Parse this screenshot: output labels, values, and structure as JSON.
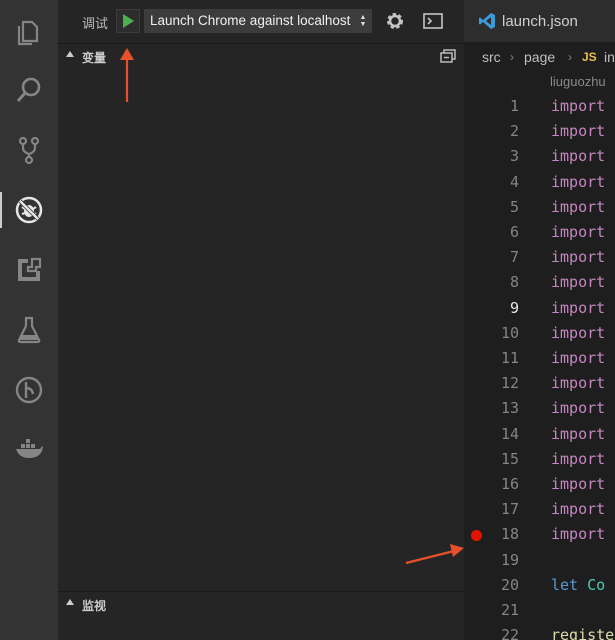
{
  "activity_bar": {
    "items": [
      {
        "name": "explorer",
        "icon": "files-icon"
      },
      {
        "name": "search",
        "icon": "search-icon"
      },
      {
        "name": "source-control",
        "icon": "git-branch-icon"
      },
      {
        "name": "debug",
        "icon": "debug-no-bug-icon",
        "active": true
      },
      {
        "name": "extensions",
        "icon": "extensions-icon"
      },
      {
        "name": "test",
        "icon": "flask-icon"
      },
      {
        "name": "git-lens",
        "icon": "git-history-icon"
      },
      {
        "name": "docker",
        "icon": "docker-whale-icon"
      }
    ]
  },
  "debug": {
    "title": "调试",
    "start_icon": "play-icon",
    "configuration": "Launch Chrome against localhost",
    "settings_icon": "gear-icon",
    "console_icon": "terminal-icon",
    "variables_header": "变量",
    "watch_header": "监视"
  },
  "editor": {
    "tab_label": "launch.json",
    "breadcrumb": [
      "src",
      "page",
      "JS",
      "in"
    ],
    "blame": "liuguozhu",
    "lines": [
      {
        "n": "1",
        "code": "import"
      },
      {
        "n": "2",
        "code": "import"
      },
      {
        "n": "3",
        "code": "import"
      },
      {
        "n": "4",
        "code": "import"
      },
      {
        "n": "5",
        "code": "import"
      },
      {
        "n": "6",
        "code": "import"
      },
      {
        "n": "7",
        "code": "import"
      },
      {
        "n": "8",
        "code": "import"
      },
      {
        "n": "9",
        "code": "import"
      },
      {
        "n": "10",
        "code": "import"
      },
      {
        "n": "11",
        "code": "import"
      },
      {
        "n": "12",
        "code": "import"
      },
      {
        "n": "13",
        "code": "import"
      },
      {
        "n": "14",
        "code": "import"
      },
      {
        "n": "15",
        "code": "import"
      },
      {
        "n": "16",
        "code": "import"
      },
      {
        "n": "17",
        "code": "import"
      },
      {
        "n": "18",
        "code": "import"
      },
      {
        "n": "19",
        "code": ""
      },
      {
        "n": "20",
        "code_kw": "let",
        "code_rest": "Co"
      },
      {
        "n": "21",
        "code": ""
      },
      {
        "n": "22",
        "code": "registe"
      }
    ]
  },
  "colors": {
    "annotation_arrow": "#e8502a",
    "breakpoint": "#e51400",
    "play": "#4caf50"
  }
}
